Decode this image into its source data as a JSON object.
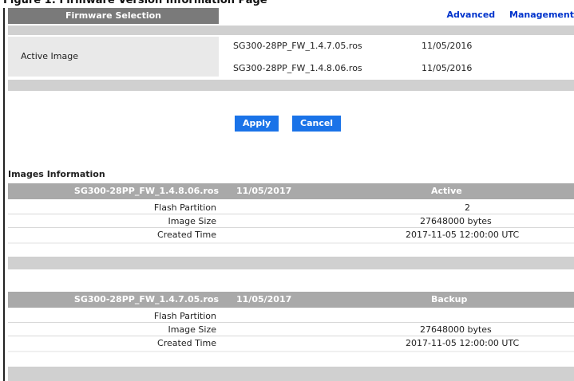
{
  "caption": "Figure 1: Firmware Version Information Page",
  "header": {
    "title": "Firmware Selection",
    "links": [
      "Advanced",
      "Management"
    ]
  },
  "selection": {
    "label": "Active Image",
    "options": [
      {
        "name": "SG300-28PP_FW_1.4.7.05.ros",
        "date": "11/05/2016"
      },
      {
        "name": "SG300-28PP_FW_1.4.8.06.ros",
        "date": "11/05/2016"
      }
    ]
  },
  "buttons": {
    "apply": "Apply",
    "cancel": "Cancel"
  },
  "info": {
    "section_title": "Images Information",
    "tables": [
      {
        "header": {
          "name": "SG300-28PP_FW_1.4.8.06.ros",
          "date": "11/05/2017",
          "status": "Active"
        },
        "rows": [
          {
            "label": "Flash Partition",
            "value": "2"
          },
          {
            "label": "Image Size",
            "value": "27648000 bytes"
          },
          {
            "label": "Created Time",
            "value": "2017-11-05 12:00:00 UTC"
          }
        ]
      },
      {
        "header": {
          "name": "SG300-28PP_FW_1.4.7.05.ros",
          "date": "11/05/2017",
          "status": "Backup"
        },
        "rows": [
          {
            "label": "Flash Partition",
            "value": ""
          },
          {
            "label": "Image Size",
            "value": "27648000 bytes"
          },
          {
            "label": "Created Time",
            "value": "2017-11-05 12:00:00 UTC"
          }
        ]
      }
    ]
  },
  "colors": {
    "accent": "#1a73e8",
    "header": "#7a7a7a",
    "table_header": "#a9a9a9",
    "link": "#0033cc"
  }
}
